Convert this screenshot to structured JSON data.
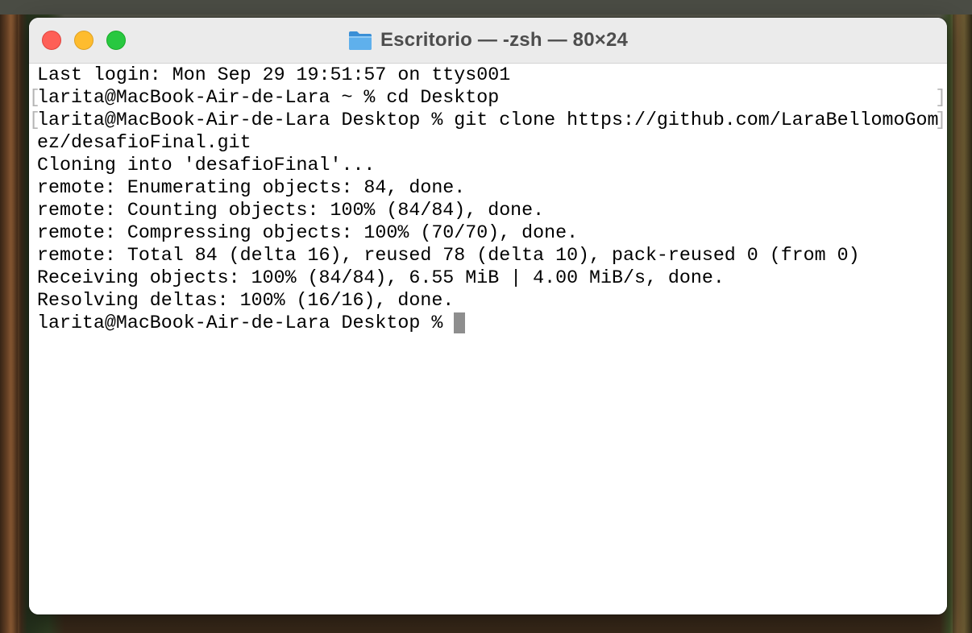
{
  "window": {
    "title": "Escritorio — -zsh — 80×24",
    "title_icon": "folder-icon"
  },
  "terminal": {
    "lines": [
      "Last login: Mon Sep 29 19:51:57 on ttys001",
      "larita@MacBook-Air-de-Lara ~ % cd Desktop",
      "larita@MacBook-Air-de-Lara Desktop % git clone https://github.com/LaraBellomoGom",
      "ez/desafioFinal.git",
      "Cloning into 'desafioFinal'...",
      "remote: Enumerating objects: 84, done.",
      "remote: Counting objects: 100% (84/84), done.",
      "remote: Compressing objects: 100% (70/70), done.",
      "remote: Total 84 (delta 16), reused 78 (delta 10), pack-reused 0 (from 0)",
      "Receiving objects: 100% (84/84), 6.55 MiB | 4.00 MiB/s, done.",
      "Resolving deltas: 100% (16/16), done.",
      "larita@MacBook-Air-de-Lara Desktop % "
    ],
    "bracket_left": "[",
    "bracket_right": "]"
  },
  "colors": {
    "close": "#fe5f57",
    "minimize": "#febc2e",
    "zoom": "#28c840",
    "cursor": "#8e8e8e"
  }
}
